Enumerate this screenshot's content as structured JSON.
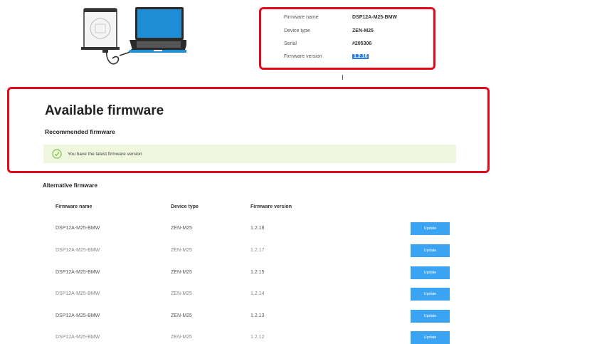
{
  "device_info": {
    "firmware_name_label": "Firmware name",
    "firmware_name": "DSP12A-M25-BMW",
    "device_type_label": "Device type",
    "device_type": "ZEN-M25",
    "serial_label": "Serial",
    "serial": "#205306",
    "firmware_version_label": "Firmware version",
    "firmware_version": "1.2.16"
  },
  "available": {
    "title": "Available firmware",
    "recommended_title": "Recommended firmware",
    "latest_message": "You have the latest firmware version"
  },
  "alternative": {
    "title": "Alternative firmware",
    "headers": {
      "name": "Firmware name",
      "type": "Device type",
      "version": "Firmware version"
    },
    "rows": [
      {
        "name": "DSP12A-M25-BMW",
        "type": "ZEN-M25",
        "version": "1.2.18",
        "button": "Update"
      },
      {
        "name": "DSP12A-M25-BMW",
        "type": "ZEN-M25",
        "version": "1.2.17",
        "button": "Update"
      },
      {
        "name": "DSP12A-M25-BMW",
        "type": "ZEN-M25",
        "version": "1.2.15",
        "button": "Update"
      },
      {
        "name": "DSP12A-M25-BMW",
        "type": "ZEN-M25",
        "version": "1.2.14",
        "button": "Update"
      },
      {
        "name": "DSP12A-M25-BMW",
        "type": "ZEN-M25",
        "version": "1.2.13",
        "button": "Update"
      },
      {
        "name": "DSP12A-M25-BMW",
        "type": "ZEN-M25",
        "version": "1.2.12",
        "button": "Update"
      }
    ]
  },
  "colors": {
    "highlight": "#e5091b",
    "button": "#3aa4f2",
    "banner": "#eff8df",
    "check": "#7bc143"
  }
}
